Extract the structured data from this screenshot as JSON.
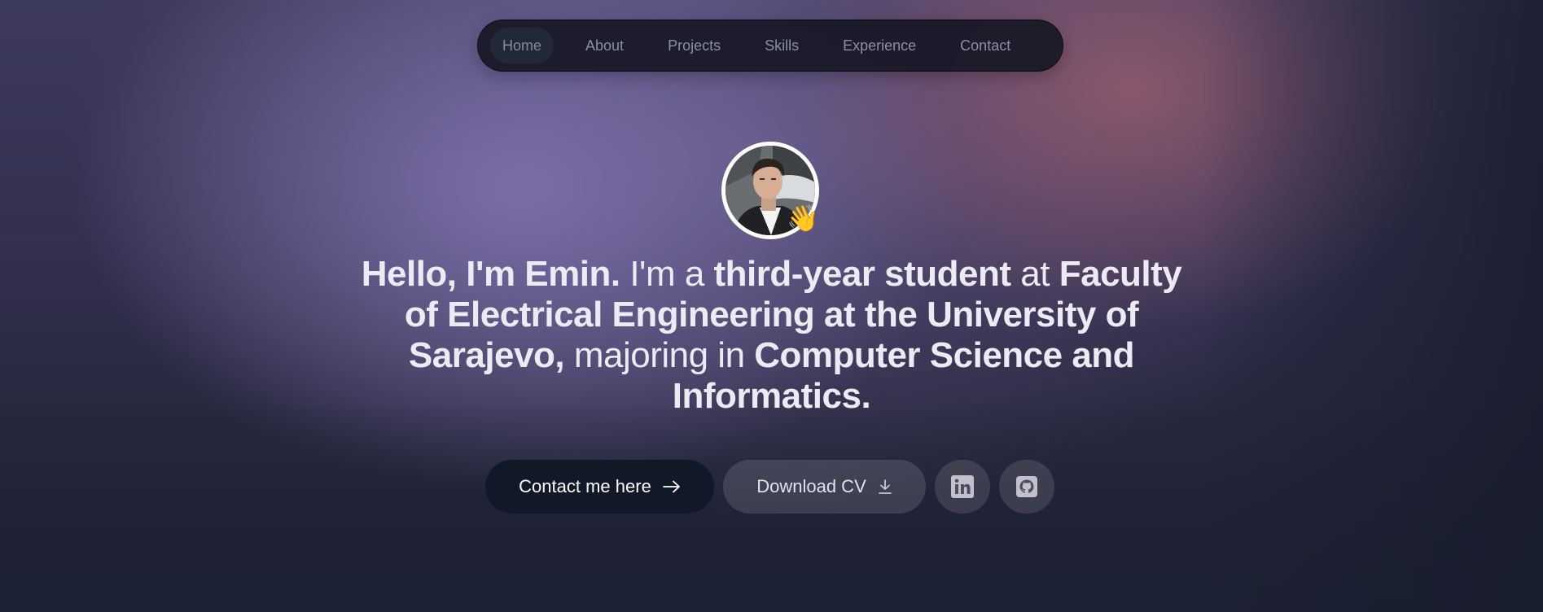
{
  "nav": {
    "items": [
      {
        "label": "Home",
        "active": true
      },
      {
        "label": "About",
        "active": false
      },
      {
        "label": "Projects",
        "active": false
      },
      {
        "label": "Skills",
        "active": false
      },
      {
        "label": "Experience",
        "active": false
      },
      {
        "label": "Contact",
        "active": false
      }
    ]
  },
  "hero": {
    "avatar_emoji": "👋",
    "headline": {
      "p1": "Hello, I'm Emin.",
      "p2": " I'm a ",
      "p3": "third-year student",
      "p4": " at ",
      "p5": "Faculty of Electrical Engineering at the University of Sarajevo,",
      "p6": " majoring in ",
      "p7": "Computer Science and Informatics."
    }
  },
  "actions": {
    "contact_label": "Contact me here",
    "contact_icon": "arrow-right-icon",
    "download_label": "Download CV",
    "download_icon": "download-icon",
    "linkedin_icon": "linkedin-icon",
    "github_icon": "github-icon"
  },
  "colors": {
    "primary_button": "#111827",
    "nav_background": "#181826",
    "headline_text": "#eceaf2"
  }
}
